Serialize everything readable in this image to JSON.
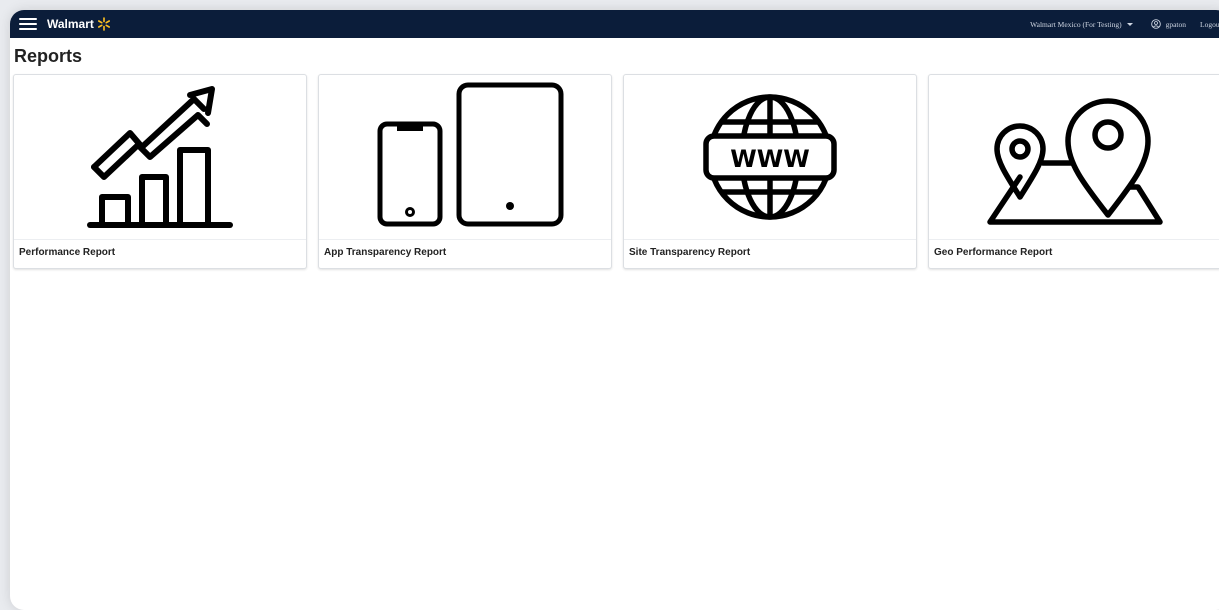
{
  "header": {
    "brand_name": "Walmart",
    "org_selector": "Walmart Mexico (For Testing)",
    "username": "gpaton",
    "logout_label": "Logout",
    "bar_color": "#0b1d3a",
    "spark_color": "#ffc220"
  },
  "page": {
    "title": "Reports"
  },
  "reports": [
    {
      "label": "Performance Report",
      "icon": "chart-growth-icon"
    },
    {
      "label": "App Transparency Report",
      "icon": "devices-icon"
    },
    {
      "label": "Site Transparency Report",
      "icon": "globe-www-icon"
    },
    {
      "label": "Geo Performance Report",
      "icon": "map-pin-icon"
    }
  ],
  "icons": {
    "www_text": "WWW"
  }
}
